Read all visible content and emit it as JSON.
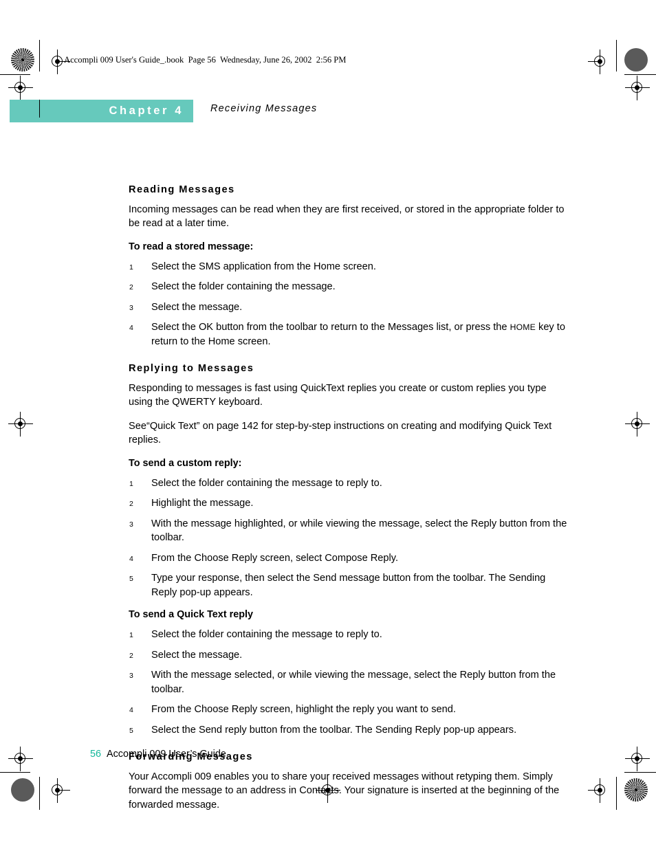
{
  "page_header": {
    "text": "Accompli 009 User's Guide_.book  Page 56  Wednesday, June 26, 2002  2:56 PM"
  },
  "chapter": {
    "label": "Chapter 4",
    "title": "Receiving Messages",
    "bar_color": "#66c9bc"
  },
  "sections": [
    {
      "heading": "Reading Messages",
      "intro": "Incoming messages can be read when they are first received, or stored in the appropriate folder to be read at a later time.",
      "subhead": "To read a stored message:",
      "steps": [
        {
          "num": "1",
          "text": "Select the SMS application from the Home screen."
        },
        {
          "num": "2",
          "text": "Select the folder containing the message."
        },
        {
          "num": "3",
          "text": "Select the message."
        },
        {
          "num": "4",
          "text_before": "Select the OK button from the toolbar to return to the Messages list, or press the ",
          "smallcaps": "HOME",
          "text_after": " key to return to the Home screen."
        }
      ]
    },
    {
      "heading": "Replying to Messages",
      "intro": "Responding to messages is fast using QuickText replies you create or custom replies you type using the QWERTY keyboard.",
      "intro2": "See“Quick Text” on page 142 for step-by-step instructions on creating and modifying Quick Text replies.",
      "subhead": "To send a custom reply:",
      "steps": [
        {
          "num": "1",
          "text": "Select the folder containing the message to reply to."
        },
        {
          "num": "2",
          "text": "Highlight the message."
        },
        {
          "num": "3",
          "text": "With the message highlighted, or while viewing the message, select the Reply button from the toolbar."
        },
        {
          "num": "4",
          "text": "From the Choose Reply screen, select Compose Reply."
        },
        {
          "num": "5",
          "text": "Type your response, then select the Send message button from the toolbar. The Sending Reply pop-up appears."
        }
      ],
      "subhead2": "To send a Quick Text reply",
      "steps2": [
        {
          "num": "1",
          "text": "Select the folder containing the message to reply to."
        },
        {
          "num": "2",
          "text": "Select the message."
        },
        {
          "num": "3",
          "text": "With the message selected, or while viewing the message, select the Reply button from the toolbar."
        },
        {
          "num": "4",
          "text": "From the Choose Reply screen, highlight the reply you want to send."
        },
        {
          "num": "5",
          "text": "Select the Send reply button from the toolbar. The Sending Reply pop-up appears."
        }
      ]
    },
    {
      "heading": "Forwarding Messages",
      "intro": "Your Accompli 009 enables you to share your received messages without retyping them. Simply forward the message to an address in Contacts. Your signature is inserted at the beginning of the forwarded message."
    }
  ],
  "footer": {
    "page_number": "56",
    "book_name": "Accompli 009 User’s Guide",
    "page_number_color": "#13b79a"
  }
}
